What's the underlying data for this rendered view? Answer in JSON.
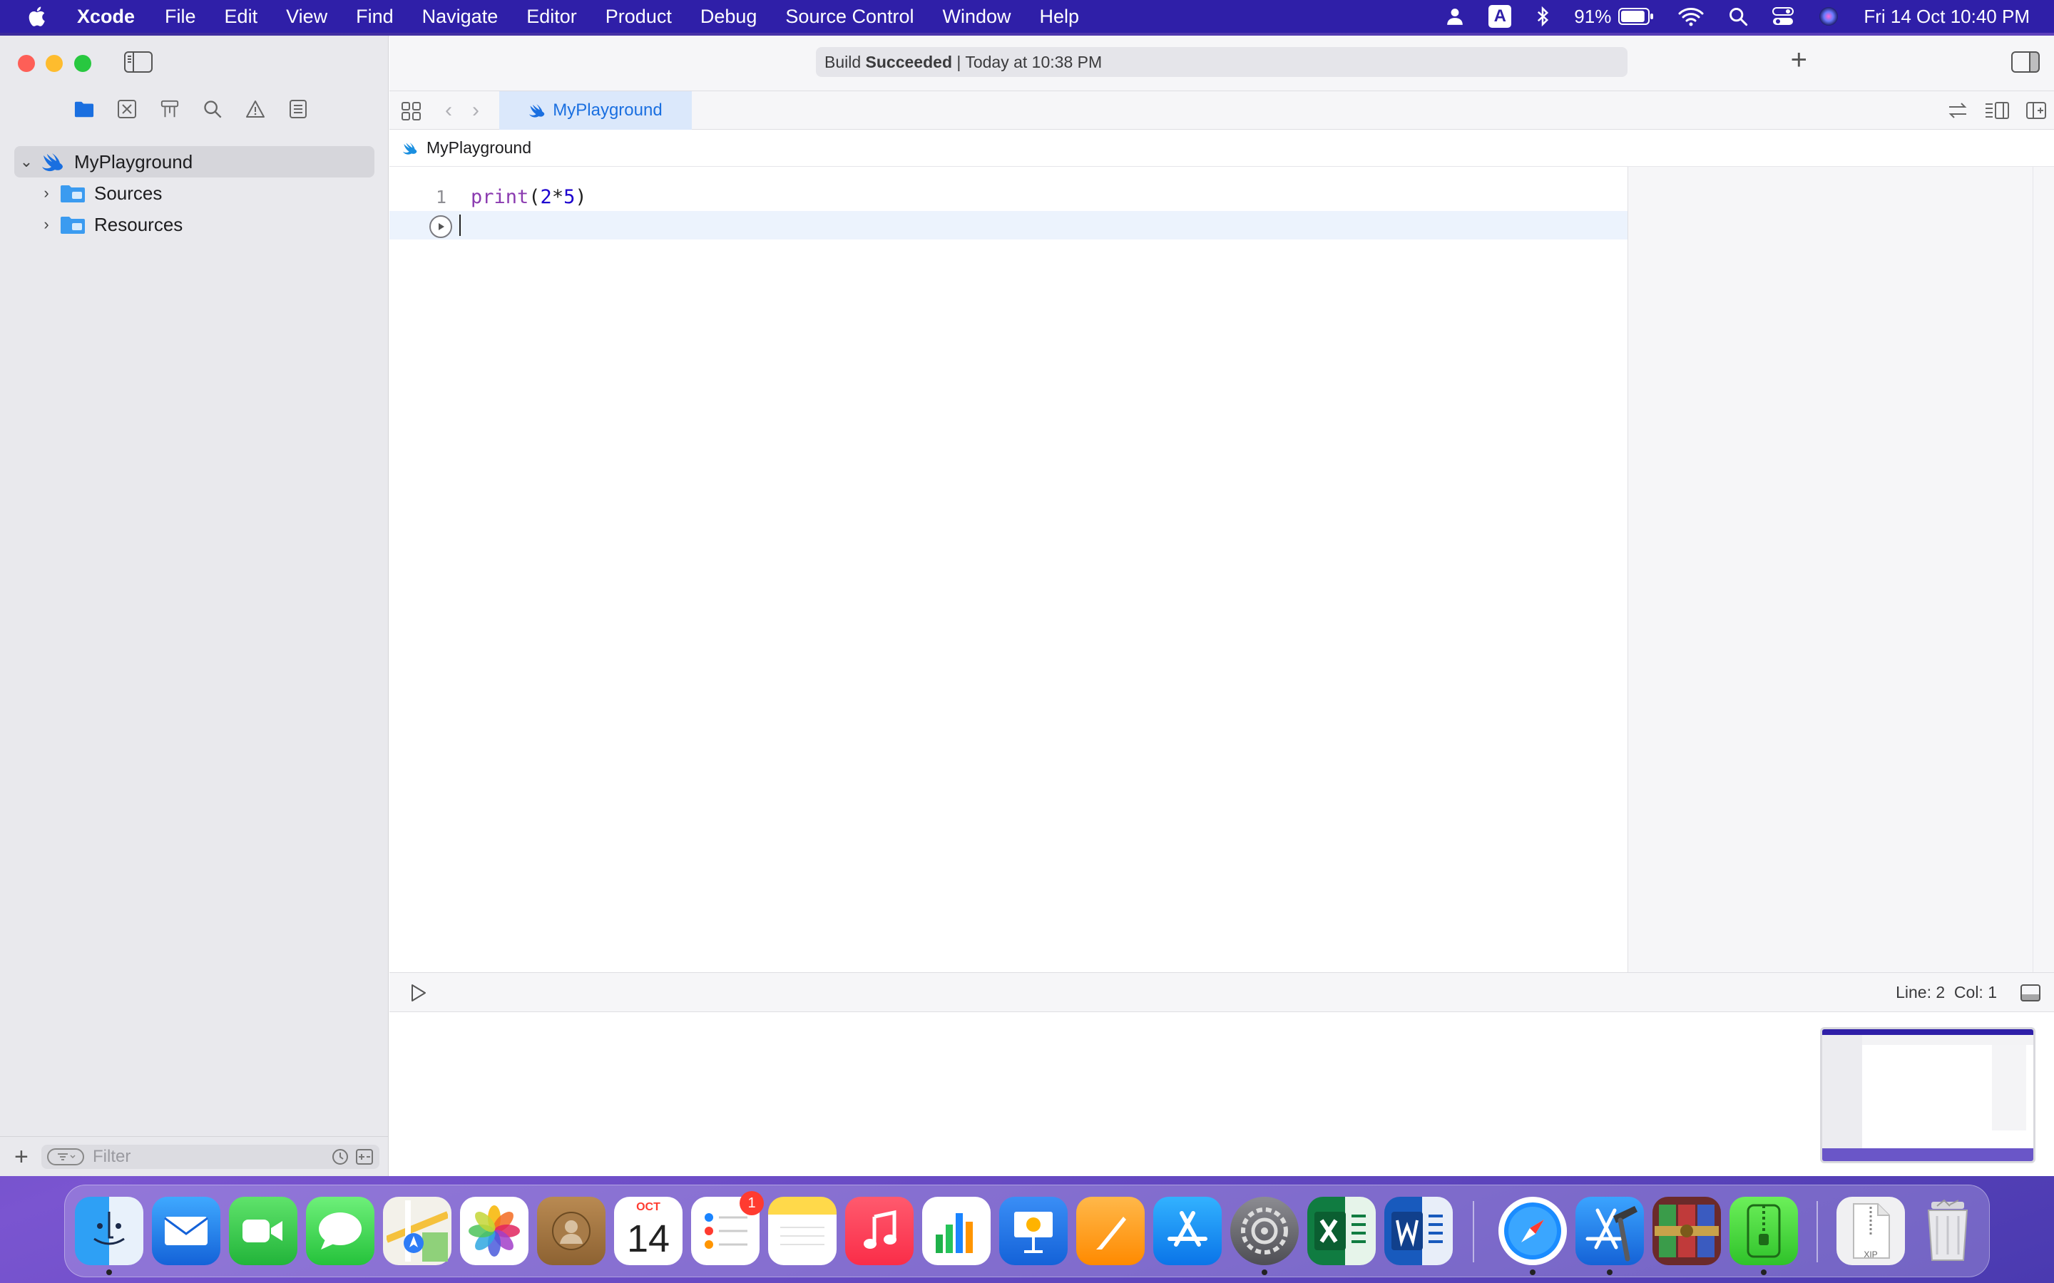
{
  "menubar": {
    "app_name": "Xcode",
    "items": [
      "File",
      "Edit",
      "View",
      "Find",
      "Navigate",
      "Editor",
      "Product",
      "Debug",
      "Source Control",
      "Window",
      "Help"
    ],
    "input_source": "A",
    "battery_percent": "91%",
    "battery_level": 0.91,
    "datetime": "Fri 14 Oct  10:40 PM"
  },
  "titlebar": {
    "activity_prefix": "Build ",
    "activity_status": "Succeeded",
    "activity_suffix": " | Today at 10:38 PM"
  },
  "navigator": {
    "tree": [
      {
        "label": "MyPlayground",
        "icon": "swift-icon",
        "expanded": true,
        "selected": true
      },
      {
        "label": "Sources",
        "icon": "folder-icon",
        "expanded": false
      },
      {
        "label": "Resources",
        "icon": "folder-icon",
        "expanded": false
      }
    ],
    "filter_placeholder": "Filter"
  },
  "tabbar": {
    "active_tab": "MyPlayground"
  },
  "jumpbar": {
    "crumb": "MyPlayground"
  },
  "editor": {
    "lines": [
      {
        "number": "1",
        "tokens": [
          {
            "text": "print",
            "kind": "fn"
          },
          {
            "text": "(",
            "kind": "p"
          },
          {
            "text": "2",
            "kind": "num"
          },
          {
            "text": "*",
            "kind": "p"
          },
          {
            "text": "5",
            "kind": "num"
          },
          {
            "text": ")",
            "kind": "p"
          }
        ]
      }
    ]
  },
  "statusbar": {
    "position": "Line: 2  Col: 1"
  },
  "dock": {
    "calendar_month": "OCT",
    "calendar_day": "14",
    "reminders_badge": "1",
    "archive_label": "XIP"
  },
  "colors": {
    "menubar_bg": "#2f1fa8",
    "accent": "#1a6fe0",
    "swift_keyword": "#8b3bb0",
    "number": "#1c00cf"
  }
}
